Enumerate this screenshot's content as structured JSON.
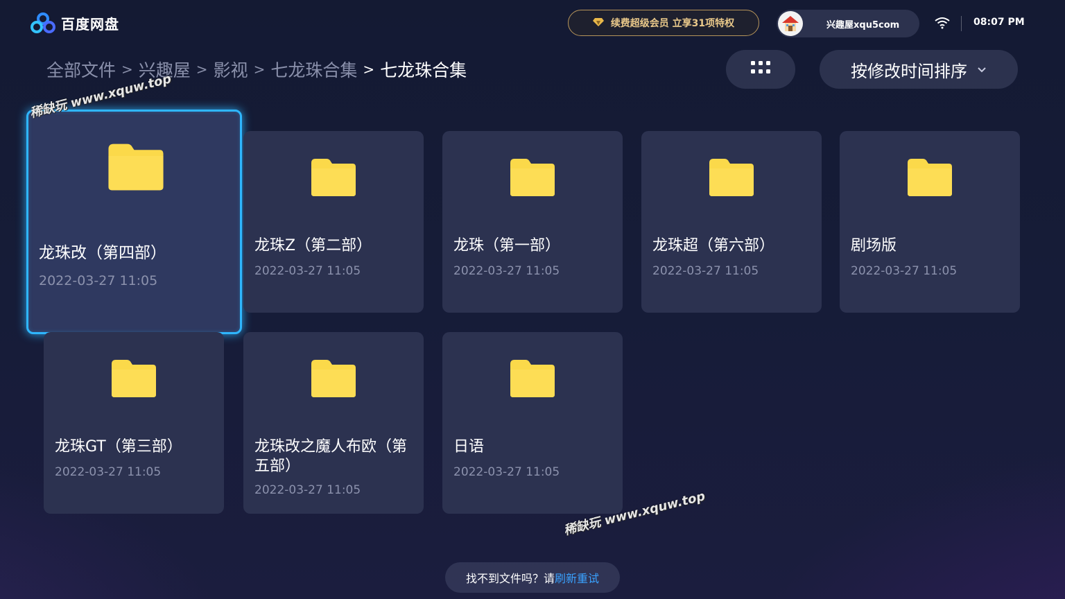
{
  "header": {
    "app_name": "百度网盘",
    "vip_promo": "续费超级会员 立享31项特权",
    "user_name": "兴趣屋xqu5com",
    "time": "08:07 PM"
  },
  "breadcrumb": [
    {
      "label": "全部文件"
    },
    {
      "label": "兴趣屋"
    },
    {
      "label": "影视"
    },
    {
      "label": "七龙珠合集"
    },
    {
      "label": "七龙珠合集"
    }
  ],
  "sort": {
    "label": "按修改时间排序"
  },
  "files": [
    {
      "name": "龙珠改（第四部）",
      "date": "2022-03-27  11:05",
      "type": "folder"
    },
    {
      "name": "龙珠Z（第二部）",
      "date": "2022-03-27  11:05",
      "type": "folder"
    },
    {
      "name": "龙珠（第一部）",
      "date": "2022-03-27  11:05",
      "type": "folder"
    },
    {
      "name": "龙珠超（第六部）",
      "date": "2022-03-27  11:05",
      "type": "folder"
    },
    {
      "name": "剧场版",
      "date": "2022-03-27  11:05",
      "type": "folder"
    },
    {
      "name": "龙珠GT（第三部）",
      "date": "2022-03-27  11:05",
      "type": "folder"
    },
    {
      "name": "龙珠改之魔人布欧（第五部）",
      "date": "2022-03-27  11:05",
      "type": "folder"
    },
    {
      "name": "日语",
      "date": "2022-03-27  11:05",
      "type": "folder"
    }
  ],
  "footer": {
    "prompt": "找不到文件吗？请",
    "action": "刷新重试"
  },
  "watermark": "稀缺玩 www.xquw.top",
  "colors": {
    "focus_border": "#2fb6ff",
    "folder": "#fbd94a",
    "link": "#3aa2ff",
    "vip_gold": "#e9c88a"
  }
}
